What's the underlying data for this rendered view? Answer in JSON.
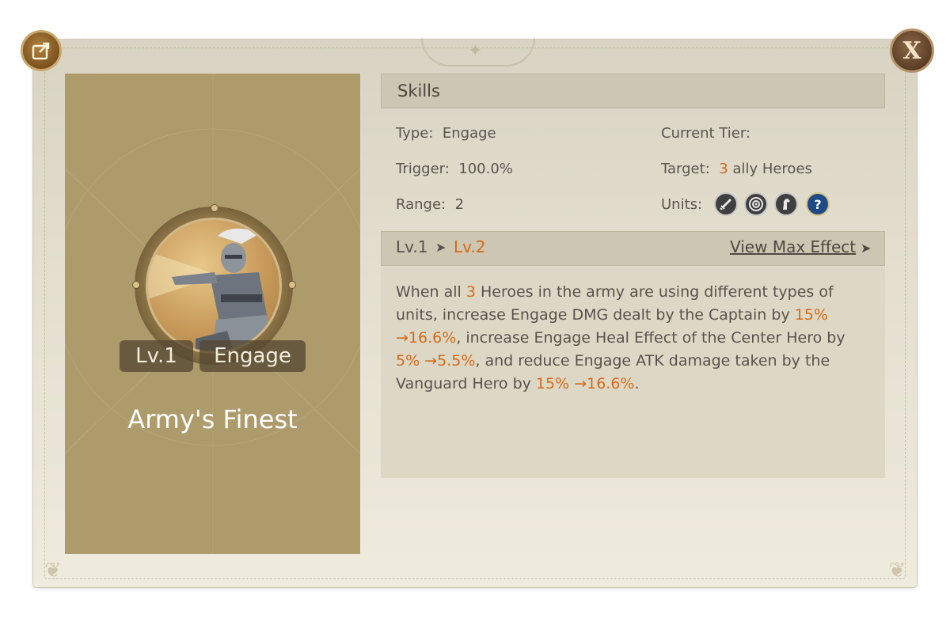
{
  "hero_card": {
    "level_badge": "Lv.1",
    "type_badge": "Engage",
    "skill_name": "Army's Finest"
  },
  "skills": {
    "header": "Skills",
    "type_label": "Type:",
    "type_value": "Engage",
    "trigger_label": "Trigger:",
    "trigger_value": "100.0%",
    "range_label": "Range:",
    "range_value": "2",
    "current_tier_label": "Current Tier:",
    "target_label": "Target:",
    "target_count": "3",
    "target_text": "ally Heroes",
    "units_label": "Units:",
    "units": [
      "sword-icon",
      "bow-target-icon",
      "cavalry-horse-icon",
      "question-help-icon"
    ],
    "unit_help_glyph": "?"
  },
  "upgrade": {
    "current_level": "Lv.1",
    "arrow": "➤",
    "next_level": "Lv.2",
    "view_max_label": "View Max Effect",
    "view_max_arrow": "➤"
  },
  "description": {
    "segments": [
      {
        "text": "When all ",
        "highlight": false
      },
      {
        "text": "3",
        "highlight": true
      },
      {
        "text": " Heroes in the army are using different types of units, increase Engage DMG dealt by the Captain by ",
        "highlight": false
      },
      {
        "text": "15% →16.6%",
        "highlight": true
      },
      {
        "text": ", increase Engage Heal Effect of the Center Hero by ",
        "highlight": false
      },
      {
        "text": "5% →5.5%",
        "highlight": true
      },
      {
        "text": ", and reduce Engage ATK damage taken by the Vanguard Hero by ",
        "highlight": false
      },
      {
        "text": "15% →16.6%",
        "highlight": true
      },
      {
        "text": ".",
        "highlight": false
      }
    ]
  },
  "controls": {
    "close_glyph": "X"
  },
  "colors": {
    "highlight": "#d66a17",
    "card": "#ad9b6c",
    "panel": "#e4dfcf"
  }
}
